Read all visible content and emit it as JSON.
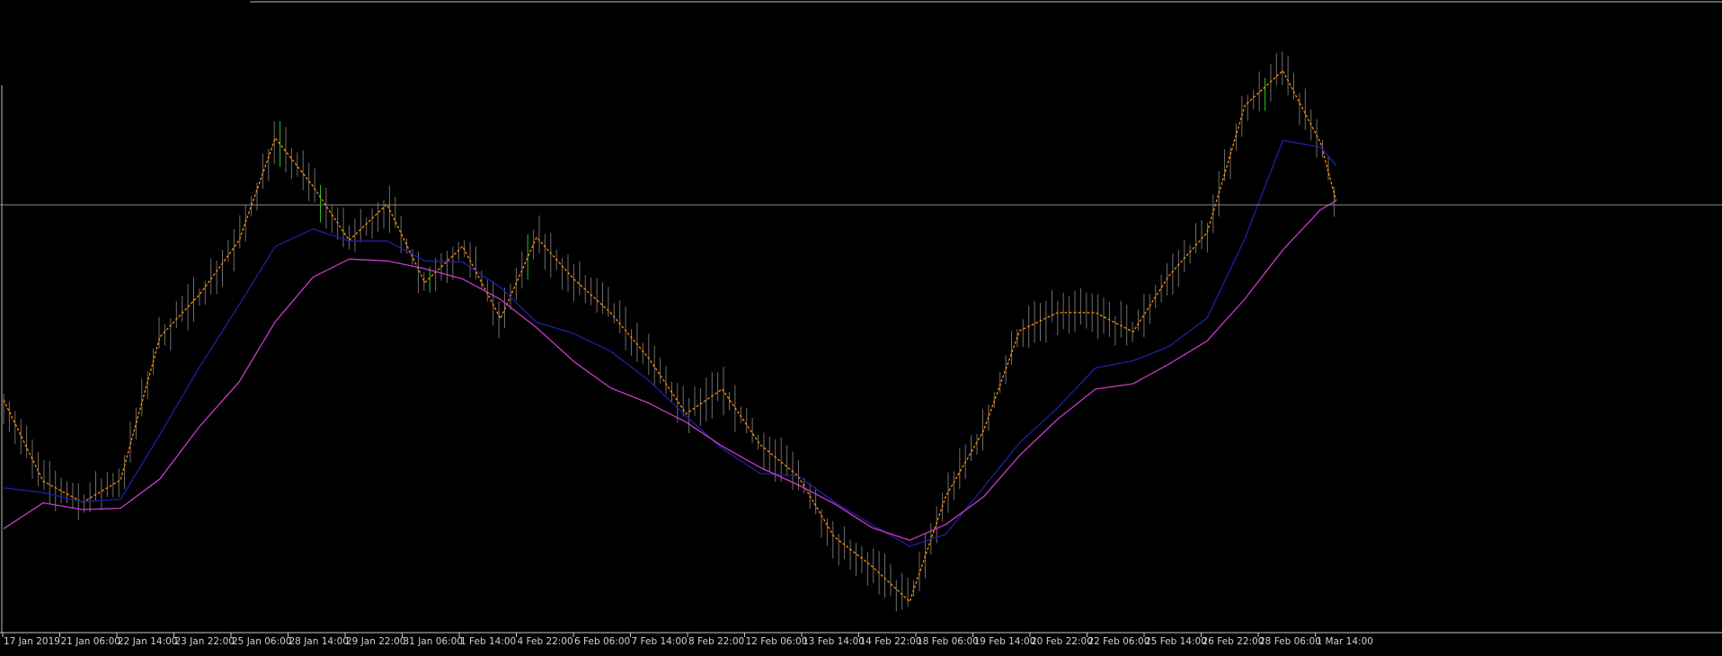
{
  "chart_data": {
    "type": "line",
    "title": "",
    "xlabel": "",
    "ylabel": "",
    "grid": false,
    "legend": "none",
    "colors": {
      "background": "#000000",
      "price": "#6e6e6e",
      "price_bull_accent": "#22c322",
      "ma_fast": "#ff8c00",
      "ma_mid": "#1f1fa8",
      "ma_slow": "#c83cc8",
      "h_line": "#8c8c8c",
      "axis": "#c8c8c8",
      "text": "#d2d2d2"
    },
    "x_ticks": [
      "17 Jan 2019",
      "21 Jan 06:00",
      "22 Jan 14:00",
      "23 Jan 22:00",
      "25 Jan 06:00",
      "28 Jan 14:00",
      "29 Jan 22:00",
      "31 Jan 06:00",
      "1 Feb 14:00",
      "4 Feb 22:00",
      "6 Feb 06:00",
      "7 Feb 14:00",
      "8 Feb 22:00",
      "12 Feb 06:00",
      "13 Feb 14:00",
      "14 Feb 22:00",
      "18 Feb 06:00",
      "19 Feb 14:00",
      "20 Feb 22:00",
      "22 Feb 06:00",
      "25 Feb 14:00",
      "26 Feb 22:00",
      "28 Feb 06:00",
      "1 Mar 14:00"
    ],
    "x_range": [
      0,
      100
    ],
    "y_range": [
      0,
      100
    ],
    "horizontal_line": 70.9,
    "series": [
      {
        "x": [
          0,
          2.3,
          4.6,
          6.8,
          9.1,
          11.4,
          13.7,
          15.8,
          18.0,
          20.1,
          22.3,
          24.5,
          26.7,
          28.9,
          31.0,
          33.2,
          35.3,
          37.5,
          39.7,
          41.8,
          44.0,
          46.2,
          48.3,
          50.5,
          52.7,
          54.8,
          57.0,
          59.1,
          61.3,
          63.5,
          65.7,
          67.8,
          70.0,
          72.2,
          74.4,
          76.6,
          77.5
        ],
        "y": [
          38.5,
          25,
          21.5,
          25.2,
          49,
          56,
          65,
          82,
          74,
          65,
          71,
          58,
          64,
          52,
          65.5,
          58.5,
          53,
          45.5,
          36.2,
          40.3,
          31.1,
          25.9,
          15.8,
          10.9,
          5,
          22.5,
          33.4,
          50,
          53,
          53,
          49.8,
          59.2,
          66.3,
          87.4,
          93.2,
          81.2,
          71.6
        ]
      },
      {
        "x": [
          0,
          2.3,
          4.6,
          6.8,
          9.1,
          11.4,
          13.7,
          15.8,
          18.0,
          20.1,
          22.3,
          24.5,
          26.7,
          28.9,
          31.0,
          33.2,
          35.3,
          37.5,
          39.7,
          41.8,
          44.0,
          46.2,
          48.3,
          50.5,
          52.7,
          54.8,
          57.0,
          59.1,
          61.3,
          63.5,
          65.7,
          67.8,
          70.0,
          72.2,
          74.4,
          76.6,
          77.5
        ],
        "y": [
          23.9,
          23.1,
          21.6,
          22.0,
          32.8,
          44.0,
          54.3,
          64.0,
          66.9,
          64.9,
          64.9,
          61.6,
          61.4,
          57.2,
          51.4,
          49.5,
          46.6,
          41.8,
          35.8,
          30.4,
          26.3,
          25.9,
          21.6,
          17.8,
          14.2,
          16.2,
          24.0,
          31.4,
          37.2,
          43.8,
          45.0,
          47.4,
          52.1,
          65.3,
          81.6,
          80.5,
          77.5
        ]
      },
      {
        "x": [
          0,
          2.3,
          4.6,
          6.8,
          9.1,
          11.4,
          13.7,
          15.8,
          18.0,
          20.1,
          22.3,
          24.5,
          26.7,
          28.9,
          31.0,
          33.2,
          35.3,
          37.5,
          39.7,
          41.8,
          44.0,
          46.2,
          48.3,
          50.5,
          52.7,
          54.8,
          57.0,
          59.1,
          61.3,
          63.5,
          65.7,
          67.8,
          70.0,
          72.2,
          74.4,
          76.6,
          77.5
        ],
        "y": [
          17.1,
          21.4,
          20.3,
          20.5,
          25.4,
          34.1,
          41.5,
          51.5,
          58.9,
          61.9,
          61.6,
          60.3,
          58.6,
          55.2,
          50.5,
          44.8,
          40.5,
          38.0,
          34.8,
          30.8,
          27.3,
          24.4,
          21.3,
          17.3,
          15.2,
          17.8,
          22.4,
          29.3,
          35.3,
          40.3,
          41.2,
          44.5,
          48.3,
          55.3,
          63.4,
          70.1,
          71.6
        ]
      }
    ]
  }
}
